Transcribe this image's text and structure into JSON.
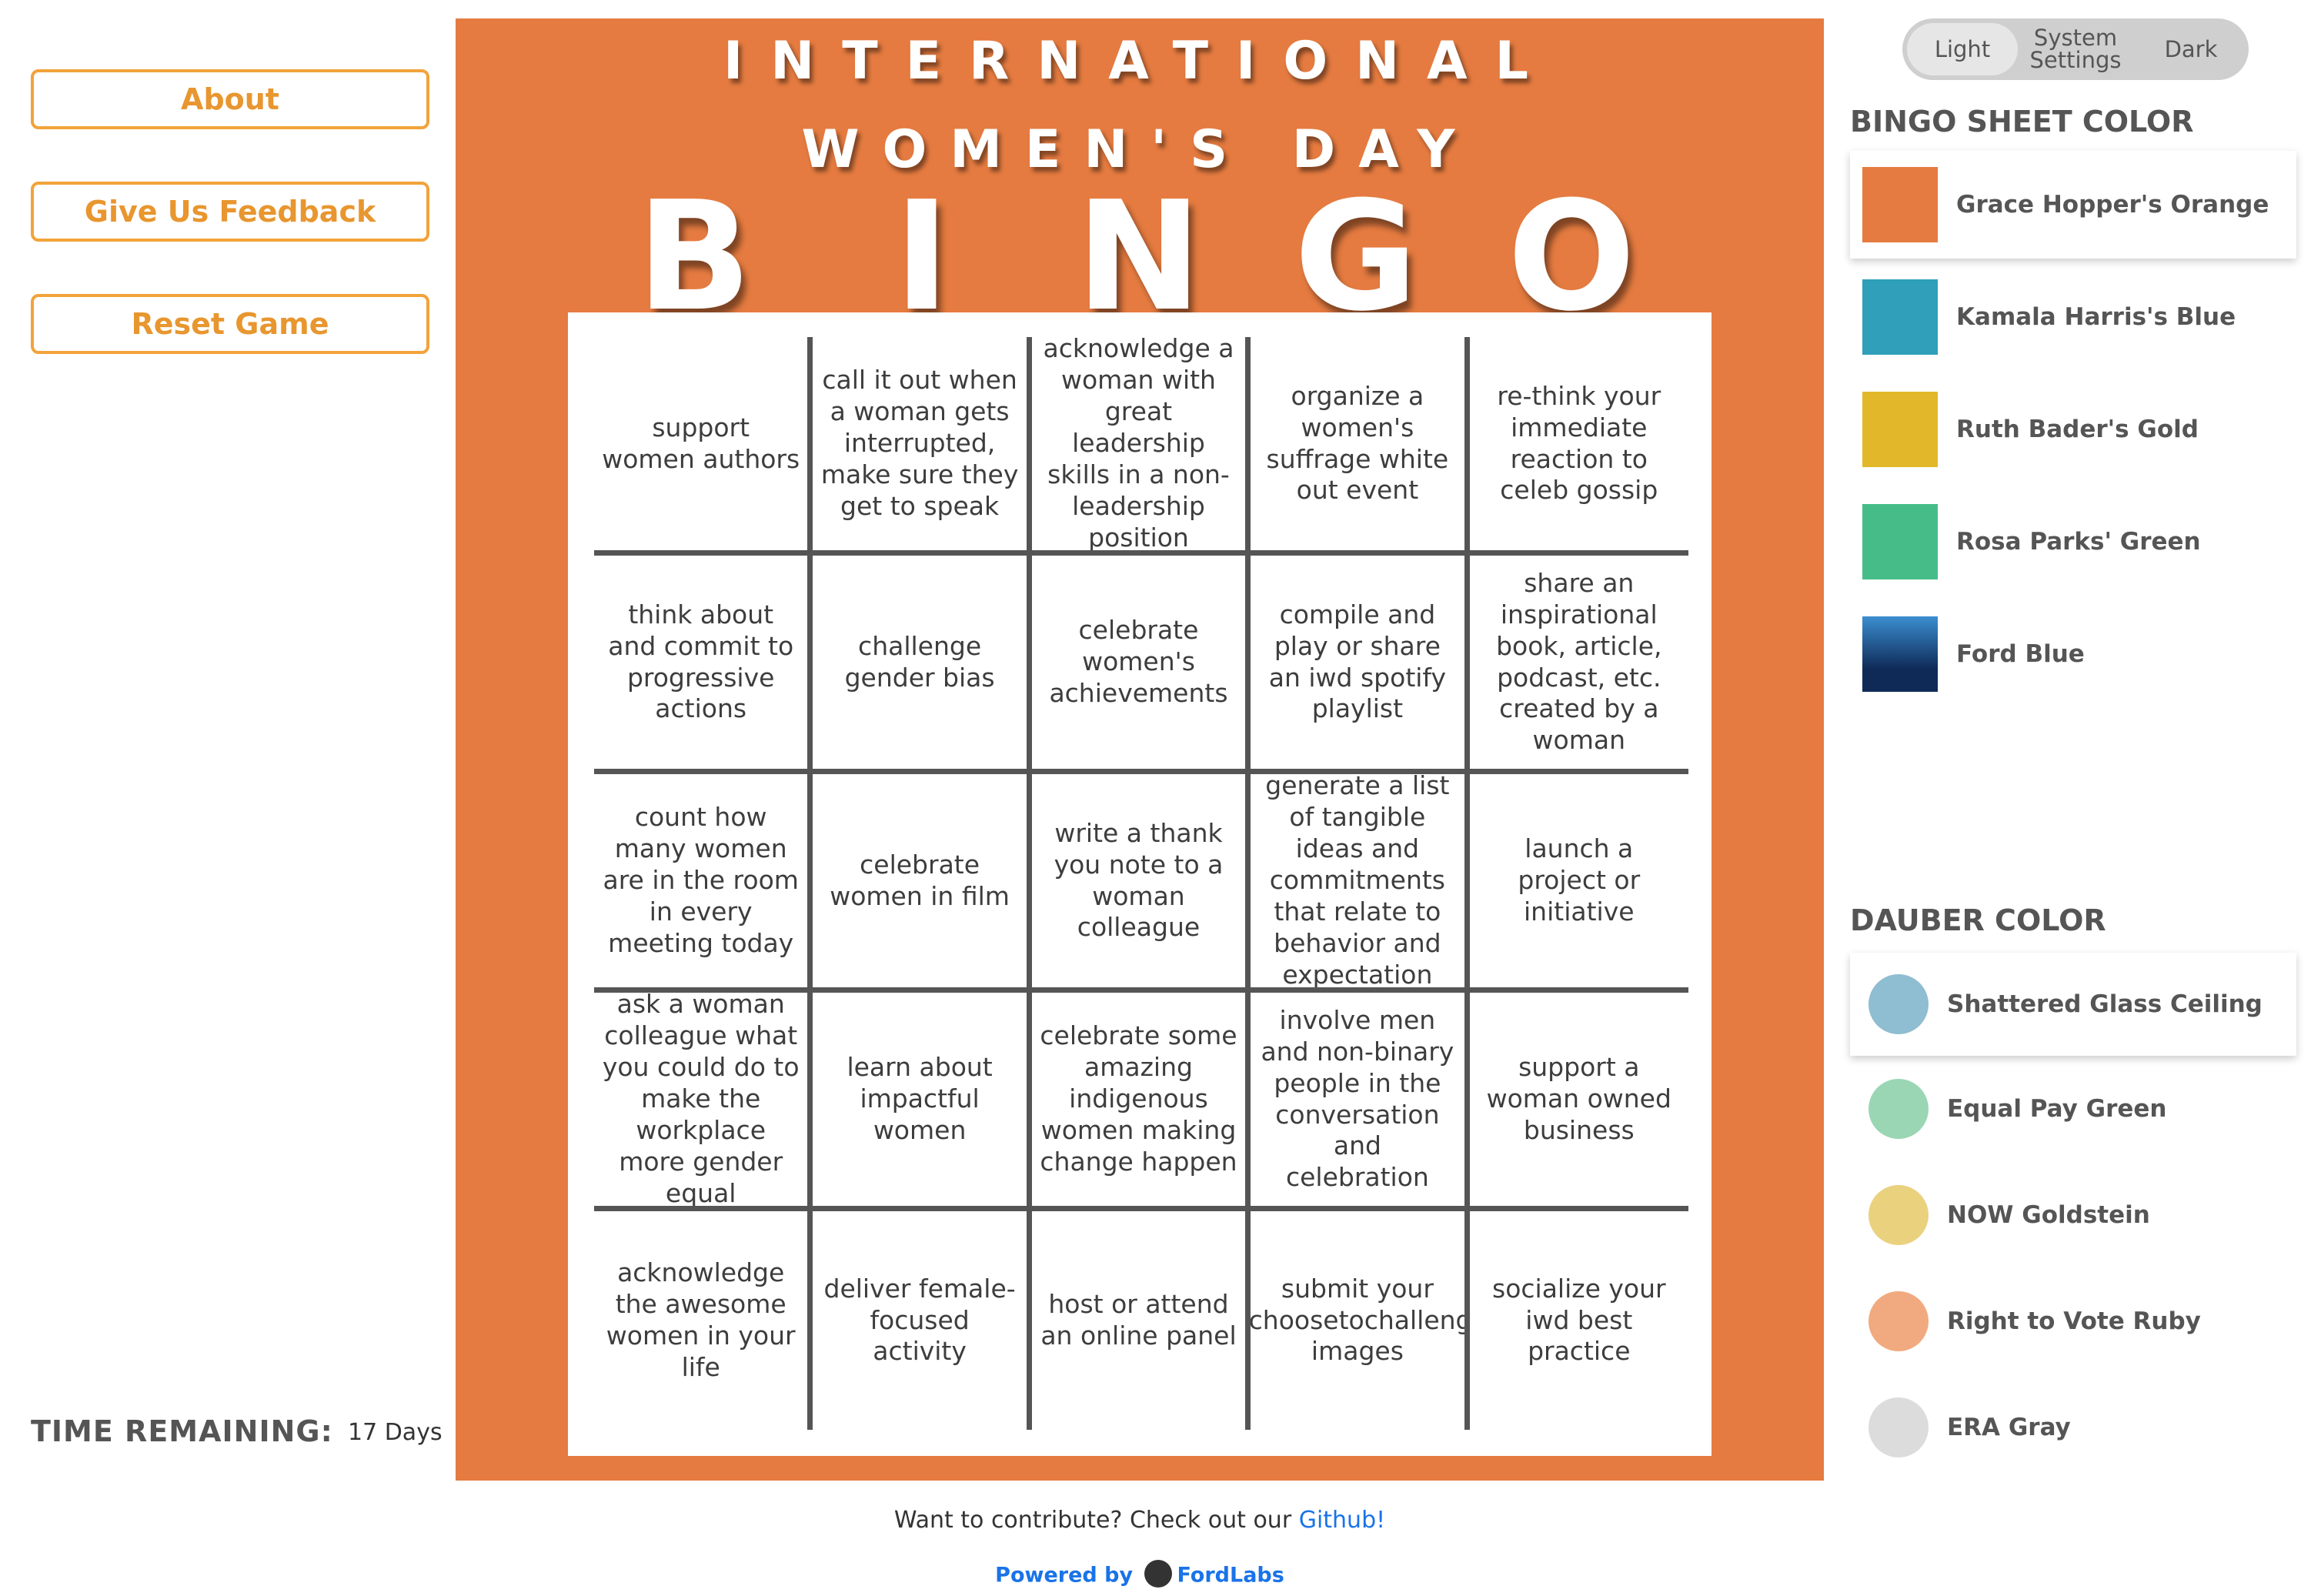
{
  "left_menu": {
    "about": "About",
    "feedback": "Give Us Feedback",
    "reset": "Reset Game"
  },
  "time": {
    "label": "TIME REMAINING:",
    "value": "17 Days"
  },
  "board": {
    "title_line1": "INTERNATIONAL",
    "title_line2": "WOMEN'S DAY",
    "bingo": [
      "B",
      "I",
      "N",
      "G",
      "O"
    ],
    "color": "#e57b40",
    "cells": [
      "support women authors",
      "call it out when a woman gets interrupted, make sure they get to speak",
      "acknowledge a woman with great leadership skills in a non-leadership position",
      "organize a women's suffrage white out event",
      "re-think your immediate reaction to celeb gossip",
      "think about and commit to progressive actions",
      "challenge gender bias",
      "celebrate women's achievements",
      "compile and play or share an iwd spotify playlist",
      "share an inspirational book, article, podcast, etc. created by a woman",
      "count how many women are in the room in every meeting today",
      "celebrate women in film",
      "write a thank you note to a woman colleague",
      "generate a list of tangible ideas and commitments that relate to behavior and expectation",
      "launch a project or initiative",
      "ask a woman colleague what you could do to make the workplace more gender equal",
      "learn about impactful women",
      "celebrate some amazing indigenous women making change happen",
      "involve men and non-binary people in the conversation and celebration",
      "support a woman owned business",
      "acknowledge the awesome women in your life",
      "deliver female-focused activity",
      "host or attend an online panel",
      "submit your #choosetochallenge images",
      "socialize your iwd best practice"
    ]
  },
  "footer": {
    "contribute_text": "Want to contribute? Check out our ",
    "github_link": "Github!",
    "powered_by": "Powered by",
    "brand": "FordLabs"
  },
  "theme": {
    "light": "Light",
    "system_1": "System",
    "system_2": "Settings",
    "dark": "Dark"
  },
  "sheet_color": {
    "title": "BINGO SHEET COLOR",
    "options": [
      {
        "label": "Grace Hopper's Orange",
        "color": "#e57b40",
        "selected": true
      },
      {
        "label": "Kamala Harris's Blue",
        "color": "#2f9fba",
        "selected": false
      },
      {
        "label": "Ruth Bader's Gold",
        "color": "#e2b72a",
        "selected": false
      },
      {
        "label": "Rosa Parks' Green",
        "color": "#46bd89",
        "selected": false
      },
      {
        "label": "Ford Blue",
        "color": "#0f2a57",
        "selected": false
      }
    ]
  },
  "dauber_color": {
    "title": "DAUBER COLOR",
    "options": [
      {
        "label": "Shattered Glass Ceiling",
        "color": "#8fbdd1",
        "selected": true
      },
      {
        "label": "Equal Pay Green",
        "color": "#9bd6b4",
        "selected": false
      },
      {
        "label": "NOW Goldstein",
        "color": "#ead17e",
        "selected": false
      },
      {
        "label": "Right to Vote Ruby",
        "color": "#f1aa7f",
        "selected": false
      },
      {
        "label": "ERA Gray",
        "color": "#dcdcdc",
        "selected": false
      }
    ]
  }
}
